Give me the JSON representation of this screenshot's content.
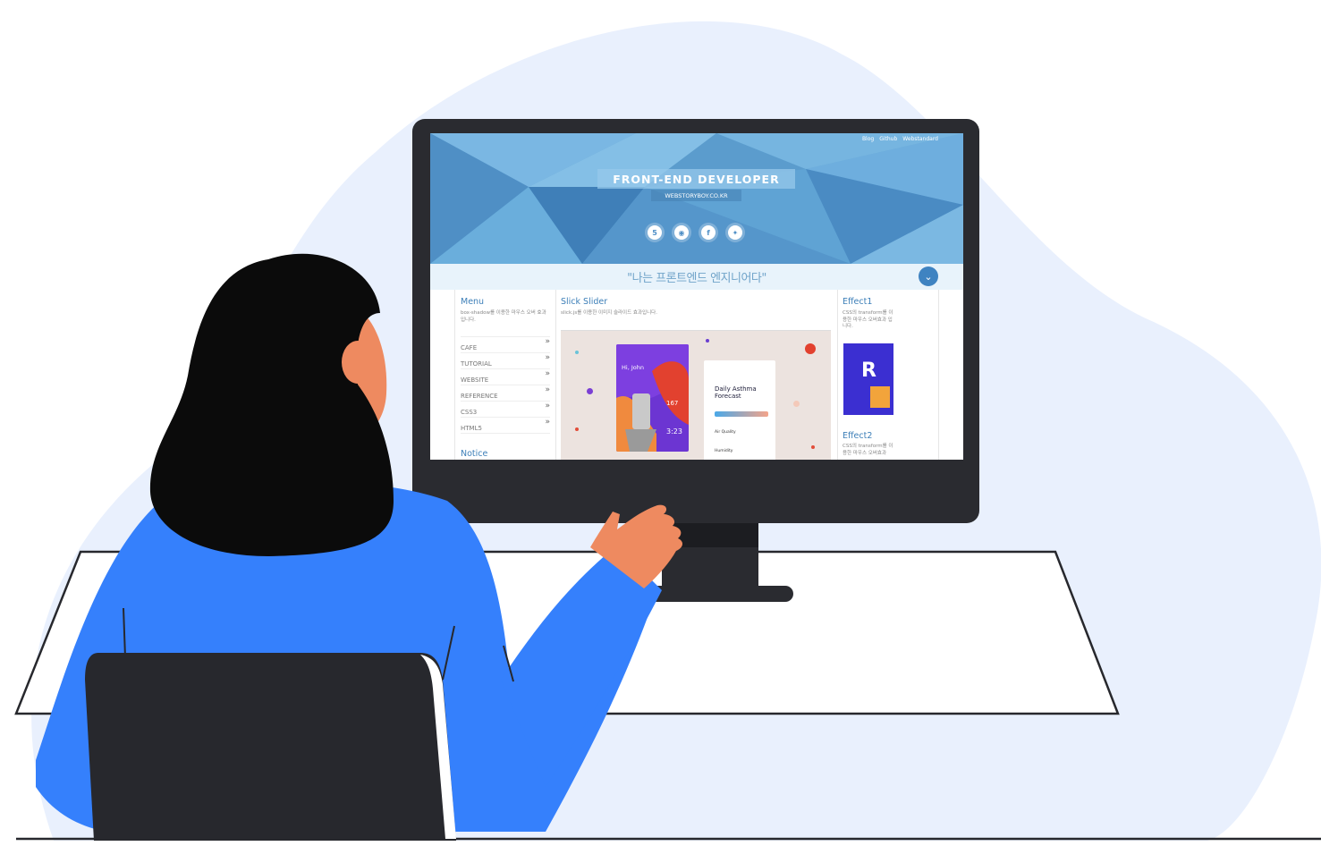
{
  "website": {
    "top_links": [
      "Blog",
      "Github",
      "Webstandard"
    ],
    "title": "FRONT-END DEVELOPER",
    "subtitle": "WEBSTORYBOY.CO.KR",
    "social_icons": [
      "html5-icon",
      "github-icon",
      "facebook-icon",
      "twitter-icon"
    ],
    "quote": "\"나는 프론트엔드 엔지니어다\"",
    "menu": {
      "title": "Menu",
      "description": "box-shadow를 이용한 마우스 오버 효과입니다.",
      "items": [
        "CAFE",
        "TUTORIAL",
        "WEBSITE",
        "REFERENCE",
        "CSS3",
        "HTML5"
      ]
    },
    "notice_title": "Notice",
    "slider": {
      "title": "Slick Slider",
      "description": "slick.js를 이용한 이미지 슬라이드 효과입니다.",
      "card1": {
        "greeting": "Hi, John",
        "value1": "167",
        "value2": "3:23"
      },
      "card2": {
        "title": "Daily Asthma Forecast",
        "row1": "Air Quality",
        "row2": "Humidity"
      }
    },
    "effect1": {
      "title": "Effect1",
      "description": "CSS의 transform를 이용한 마우스 오버효과 입니다.",
      "badge": "R"
    },
    "effect2": {
      "title": "Effect2",
      "description": "CSS의 transform를 이용한 마우스 오버효과"
    }
  },
  "colors": {
    "blob": "#e8f0fd",
    "monitor": "#2a2b30",
    "shirt": "#3580fc",
    "skin": "#ee8a60",
    "hair": "#0b0b0b",
    "chair": "#27282d",
    "accent": "#3d7fb8"
  }
}
